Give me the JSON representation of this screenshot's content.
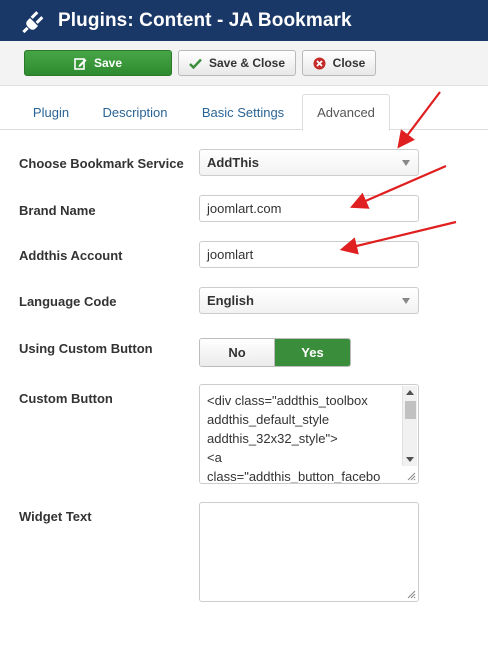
{
  "header": {
    "title": "Plugins: Content - JA Bookmark",
    "icon": "plug-icon"
  },
  "toolbar": {
    "save_label": "Save",
    "save_close_label": "Save & Close",
    "close_label": "Close"
  },
  "tabs": [
    {
      "label": "Plugin",
      "active": false
    },
    {
      "label": "Description",
      "active": false
    },
    {
      "label": "Basic Settings",
      "active": false
    },
    {
      "label": "Advanced",
      "active": true
    }
  ],
  "form": {
    "bookmark_service": {
      "label": "Choose Bookmark Service",
      "value": "AddThis"
    },
    "brand_name": {
      "label": "Brand Name",
      "value": "joomlart.com"
    },
    "addthis_account": {
      "label": "Addthis Account",
      "value": "joomlart"
    },
    "language_code": {
      "label": "Language Code",
      "value": "English"
    },
    "custom_button_toggle": {
      "label": "Using Custom Button",
      "no": "No",
      "yes": "Yes",
      "selected": "Yes"
    },
    "custom_button": {
      "label": "Custom Button",
      "lines": [
        "<div class=\"addthis_toolbox",
        "addthis_default_style",
        "addthis_32x32_style\">",
        "<a",
        "class=\"addthis_button_facebo"
      ]
    },
    "widget_text": {
      "label": "Widget Text",
      "value": ""
    }
  },
  "colors": {
    "header_bg": "#1a3867",
    "save_green": "#2f8a2f",
    "yes_green": "#3a8d3a",
    "annotation_red": "#e02020"
  }
}
